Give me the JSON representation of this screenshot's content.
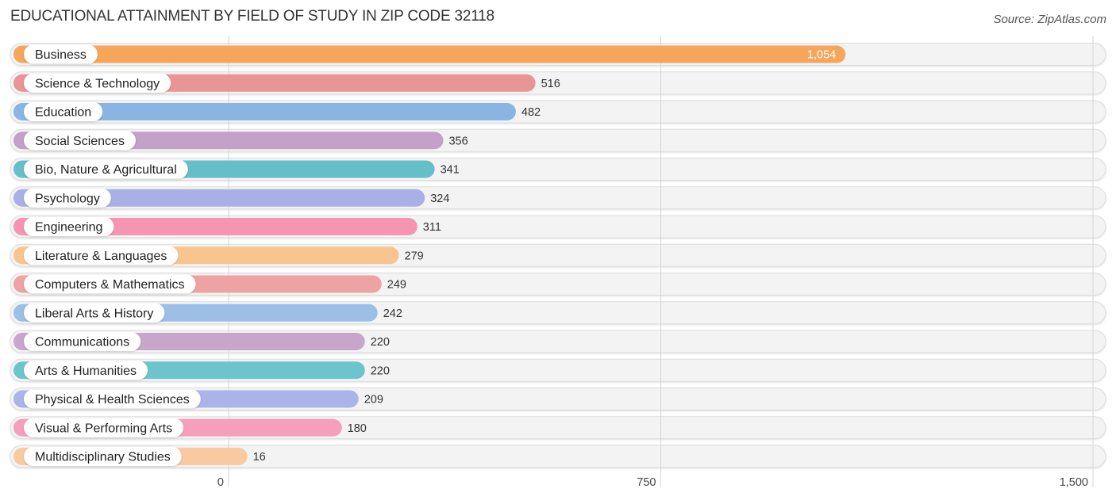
{
  "header": {
    "title": "EDUCATIONAL ATTAINMENT BY FIELD OF STUDY IN ZIP CODE 32118",
    "source": "Source: ZipAtlas.com"
  },
  "chart_data": {
    "type": "bar",
    "orientation": "horizontal",
    "title": "EDUCATIONAL ATTAINMENT BY FIELD OF STUDY IN ZIP CODE 32118",
    "xlabel": "",
    "ylabel": "",
    "xlim": [
      0,
      1500
    ],
    "x_ticks": [
      0,
      750,
      1500
    ],
    "x_tick_labels": [
      "0",
      "750",
      "1,500"
    ],
    "grid": true,
    "categories": [
      "Business",
      "Science & Technology",
      "Education",
      "Social Sciences",
      "Bio, Nature & Agricultural",
      "Psychology",
      "Engineering",
      "Literature & Languages",
      "Computers & Mathematics",
      "Liberal Arts & History",
      "Communications",
      "Arts & Humanities",
      "Physical & Health Sciences",
      "Visual & Performing Arts",
      "Multidisciplinary Studies"
    ],
    "values": [
      1054,
      516,
      482,
      356,
      341,
      324,
      311,
      279,
      249,
      242,
      220,
      220,
      209,
      180,
      16
    ],
    "value_labels": [
      "1,054",
      "516",
      "482",
      "356",
      "341",
      "324",
      "311",
      "279",
      "249",
      "242",
      "220",
      "220",
      "209",
      "180",
      "16"
    ],
    "colors": [
      "#f5a65b",
      "#ea9595",
      "#8ab4e4",
      "#c3a1c8",
      "#65bfc9",
      "#a9b0e6",
      "#f595b3",
      "#f8c591",
      "#eea3a3",
      "#9cbfe6",
      "#c8a6cb",
      "#6cc5cd",
      "#abb4e8",
      "#f59fbd",
      "#f9c99f"
    ]
  }
}
